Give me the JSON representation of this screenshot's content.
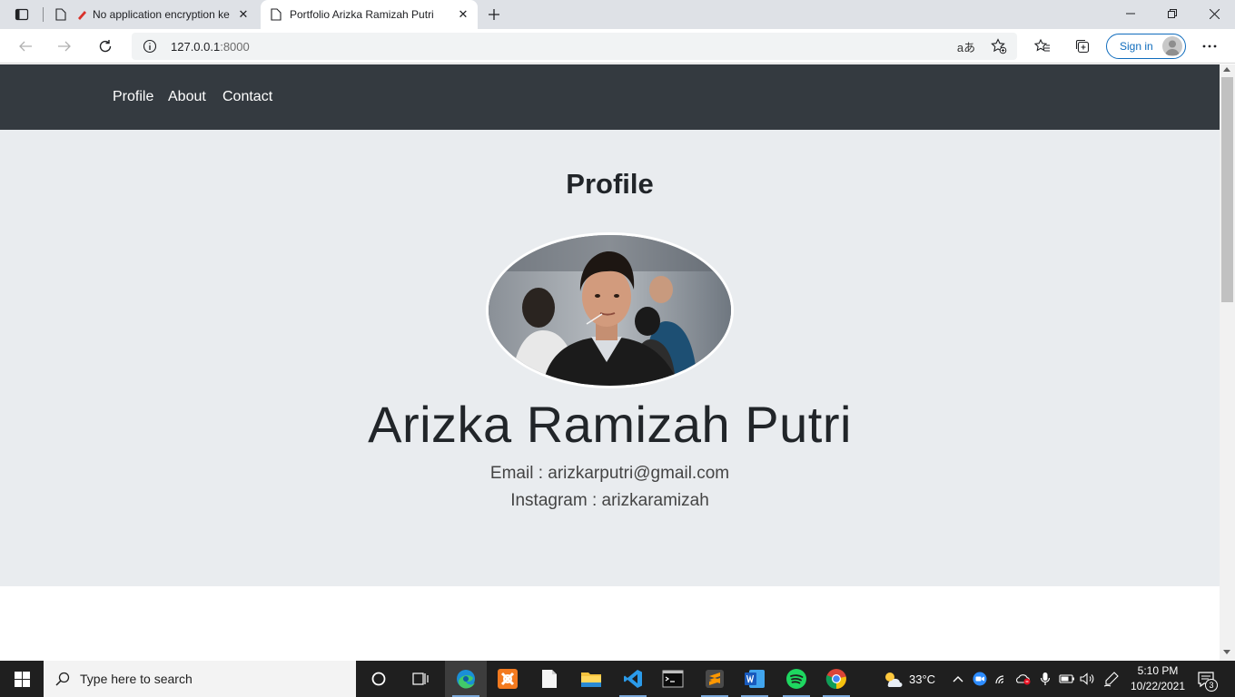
{
  "browser": {
    "tabs": [
      {
        "title": "No application encryption ke",
        "close": "✕"
      },
      {
        "title": "Portfolio Arizka Ramizah Putri",
        "close": "✕"
      }
    ],
    "address": {
      "host": "127.0.0.1",
      "port": ":8000"
    },
    "read_aloud": "aあ",
    "signin_label": "Sign in"
  },
  "page": {
    "nav": [
      "Profile",
      "About",
      "Contact"
    ],
    "section_title": "Profile",
    "name": "Arizka Ramizah Putri",
    "email_line": "Email : arizkarputri@gmail.com",
    "instagram_line": "Instagram : arizkaramizah"
  },
  "taskbar": {
    "search_placeholder": "Type here to search",
    "weather": "33°C",
    "time": "5:10 PM",
    "date": "10/22/2021",
    "notifications": "3"
  },
  "colors": {
    "navbar": "#343a40",
    "jumbotron": "#e9ecef",
    "accent": "#0f6cbd"
  }
}
